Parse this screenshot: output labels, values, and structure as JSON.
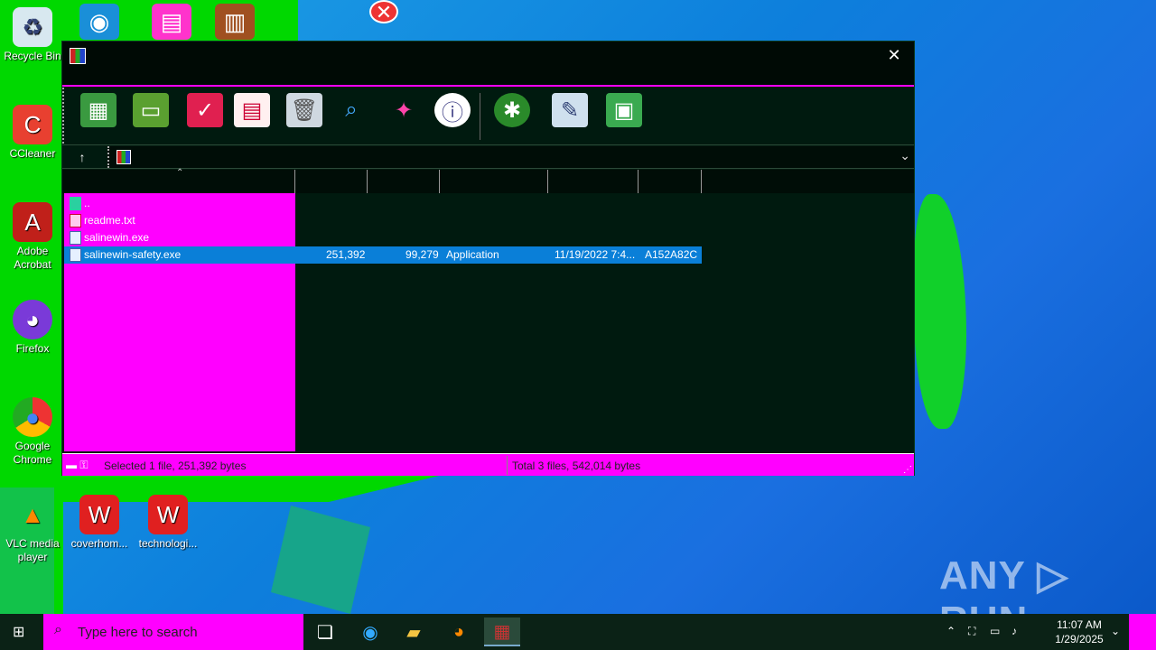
{
  "desktop": {
    "icons": [
      {
        "label": "Recycle Bin",
        "icon": "recycle-bin-icon"
      },
      {
        "label": "CCleaner",
        "icon": "ccleaner-icon"
      },
      {
        "label": "Adobe Acrobat",
        "icon": "acrobat-icon"
      },
      {
        "label": "Firefox",
        "icon": "firefox-icon"
      },
      {
        "label": "Google Chrome",
        "icon": "chrome-icon"
      },
      {
        "label": "VLC media player",
        "icon": "vlc-icon"
      },
      {
        "label": "coverhom...",
        "icon": "word-doc-icon"
      },
      {
        "label": "technologi...",
        "icon": "word-doc-icon"
      }
    ]
  },
  "window": {
    "close_glyph": "✕",
    "toolbar": [
      "add-icon",
      "extract-icon",
      "test-icon",
      "view-icon",
      "delete-icon",
      "find-icon",
      "wizard-icon",
      "info-icon",
      "virusscan-icon",
      "comment-icon",
      "sfx-icon"
    ],
    "address": {
      "up_glyph": "↑",
      "dropdown_glyph": "⌄",
      "value": ""
    },
    "files": [
      {
        "name": "..",
        "size": "",
        "packed": "",
        "type": "",
        "modified": "",
        "crc": "",
        "selected": false
      },
      {
        "name": "readme.txt",
        "size": "",
        "packed": "",
        "type": "",
        "modified": "",
        "crc": "",
        "selected": false
      },
      {
        "name": "salinewin.exe",
        "size": "",
        "packed": "",
        "type": "",
        "modified": "",
        "crc": "",
        "selected": false
      },
      {
        "name": "salinewin-safety.exe",
        "size": "251,392",
        "packed": "99,279",
        "type": "Application",
        "modified": "11/19/2022 7:4...",
        "crc": "A152A82C",
        "selected": true
      }
    ],
    "status": {
      "left": "Selected 1 file, 251,392 bytes",
      "right": "Total 3 files, 542,014 bytes"
    }
  },
  "taskbar": {
    "search_placeholder": "Type here to search",
    "clock_time": "11:07 AM",
    "clock_date": "1/29/2025"
  },
  "watermark": "ANY ▷ RUN",
  "colors": {
    "accent_magenta": "#ff00ff",
    "selection": "#0a7fd8",
    "window_bg": "#001a0f"
  }
}
